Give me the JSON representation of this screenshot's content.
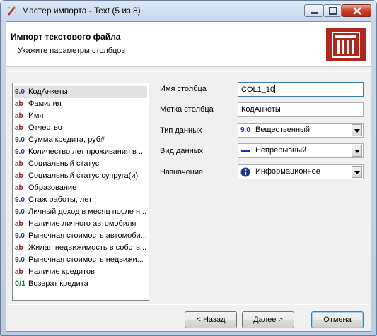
{
  "window": {
    "title": "Мастер импорта - Text (5 из 8)",
    "icon": "wizard-app-icon"
  },
  "header": {
    "title": "Импорт текстового файла",
    "subtitle": "Укажите параметры столбцов",
    "logo_icon": "text-file-import-logo"
  },
  "columns": [
    {
      "type": "9.0",
      "kind": "num",
      "name": "КодАнкеты",
      "selected": true
    },
    {
      "type": "ab",
      "kind": "str",
      "name": "Фамилия"
    },
    {
      "type": "ab",
      "kind": "str",
      "name": "Имя"
    },
    {
      "type": "ab",
      "kind": "str",
      "name": "Отчество"
    },
    {
      "type": "9.0",
      "kind": "num",
      "name": "Сумма кредита, руб#"
    },
    {
      "type": "9.0",
      "kind": "num",
      "name": "Количество лет проживания в ..."
    },
    {
      "type": "ab",
      "kind": "str",
      "name": "Социальный статус"
    },
    {
      "type": "ab",
      "kind": "str",
      "name": "Социальный статус супруга(и)"
    },
    {
      "type": "ab",
      "kind": "str",
      "name": "Образование"
    },
    {
      "type": "9.0",
      "kind": "num",
      "name": "Стаж работы, лет"
    },
    {
      "type": "9.0",
      "kind": "num",
      "name": "Личный доход в месяц после н..."
    },
    {
      "type": "ab",
      "kind": "str",
      "name": "Наличие личного автомобиля"
    },
    {
      "type": "9.0",
      "kind": "num",
      "name": "Рыночная стоимость автомоби..."
    },
    {
      "type": "ab",
      "kind": "str",
      "name": "Жилая недвижимость в собств..."
    },
    {
      "type": "9.0",
      "kind": "num",
      "name": "Рыночная стоимость недвижи..."
    },
    {
      "type": "ab",
      "kind": "str",
      "name": "Наличие кредитов"
    },
    {
      "type": "0/1",
      "kind": "bool",
      "name": "Возврат кредита"
    }
  ],
  "form": {
    "column_name_label": "Имя столбца",
    "column_name_value": "COL1_10",
    "column_label_label": "Метка столбца",
    "column_label_value": "КодАнкеты",
    "data_type_label": "Тип данных",
    "data_type_icon_text": "9.0",
    "data_type_value": "Вещественный",
    "data_kind_label": "Вид данных",
    "data_kind_icon": "continuous-dash-icon",
    "data_kind_value": "Непрерывный",
    "purpose_label": "Назначение",
    "purpose_icon": "info-icon",
    "purpose_value": "Информационное"
  },
  "buttons": {
    "back": "< Назад",
    "next": "Далее >",
    "cancel": "Отмена"
  },
  "colors": {
    "numeric_icon": "#1a2eb4",
    "string_icon": "#8a1a1a",
    "boolean_icon": "#1a7a2a",
    "logo_red": "#b3261e"
  }
}
